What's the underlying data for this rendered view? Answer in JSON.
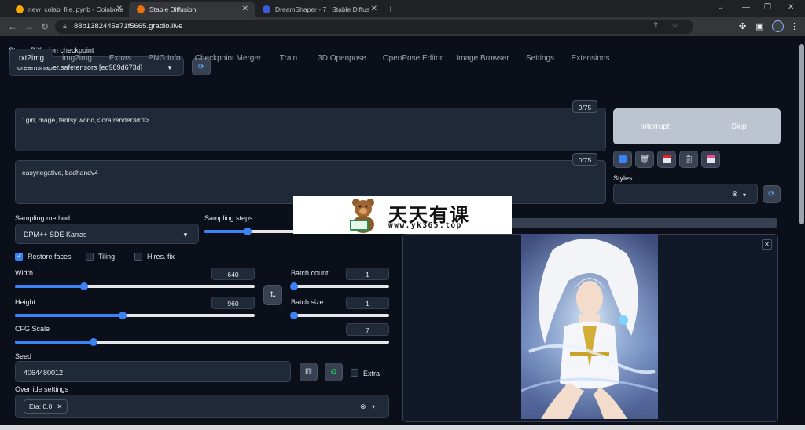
{
  "browser": {
    "tabs": [
      {
        "label": "new_colab_file.ipynb - Colaborato",
        "favicon_color": "#f9ab00"
      },
      {
        "label": "Stable Diffusion",
        "favicon_color": "#e8710a"
      },
      {
        "label": "DreamShaper - 7 | Stable Diffusio",
        "favicon_color": "#3b5bdb"
      }
    ],
    "new_tab": "+",
    "url": "88b1382445a71f5665.gradio.live"
  },
  "checkpoint": {
    "label": "Stable Diffusion checkpoint",
    "value": "dreamshaper.safetensors [ed989d673d]"
  },
  "tabs": [
    "txt2img",
    "img2img",
    "Extras",
    "PNG Info",
    "Checkpoint Merger",
    "Train",
    "3D Openpose",
    "OpenPose Editor",
    "Image Browser",
    "Settings",
    "Extensions"
  ],
  "prompt": {
    "text": "1girl, mage, fantsy world,<lora:render3d:1>",
    "counter": "9/75"
  },
  "negative_prompt": {
    "text": "easynegative, badhandv4",
    "counter": "0/75"
  },
  "buttons": {
    "interrupt": "Interrupt",
    "skip": "Skip"
  },
  "styles": {
    "label": "Styles"
  },
  "sampling": {
    "method_label": "Sampling method",
    "method_value": "DPM++ SDE Karras",
    "steps_label": "Sampling steps",
    "steps_fraction": 0.38
  },
  "options": {
    "restore_faces": "Restore faces",
    "tiling": "Tiling",
    "hires_fix": "Hires. fix"
  },
  "width": {
    "label": "Width",
    "value": "640",
    "fraction": 0.29
  },
  "height": {
    "label": "Height",
    "value": "960",
    "fraction": 0.45
  },
  "batch_count": {
    "label": "Batch count",
    "value": "1",
    "fraction": 0.0
  },
  "batch_size": {
    "label": "Batch size",
    "value": "1",
    "fraction": 0.0
  },
  "cfg": {
    "label": "CFG Scale",
    "value": "7",
    "fraction": 0.21
  },
  "seed": {
    "label": "Seed",
    "value": "4064480012",
    "extra": "Extra"
  },
  "override": {
    "label": "Override settings",
    "chip": "Eta: 0.0"
  },
  "watermark": {
    "title": "天天有课",
    "url": "www.yk365.top"
  },
  "colors": {
    "accent": "#3b82f6",
    "background": "#0b0f19",
    "panel": "#1f2937"
  }
}
